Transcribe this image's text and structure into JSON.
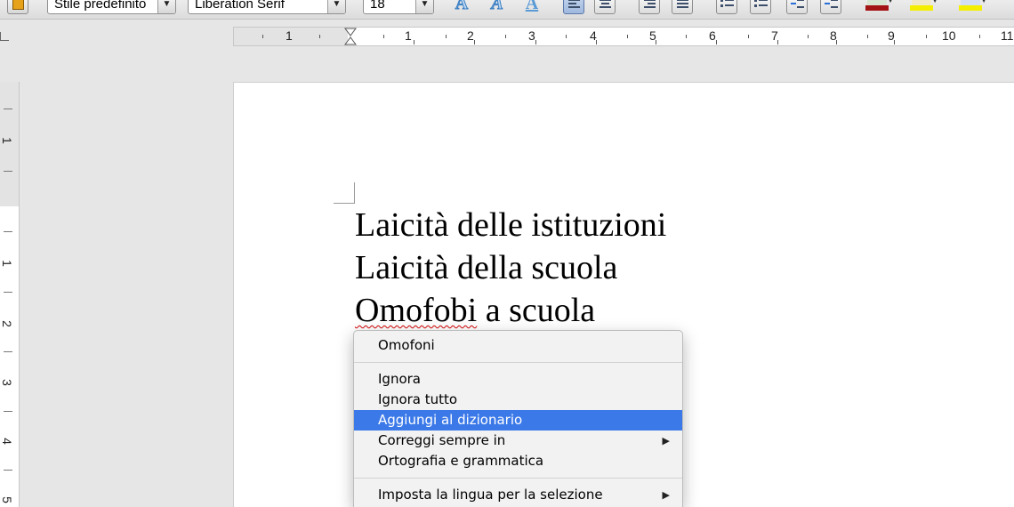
{
  "toolbar": {
    "paragraph_style": "Stile predefinito",
    "font_name": "Liberation Serif",
    "font_size": "18",
    "font_color": "#a31515",
    "highlight_color": "#f4ee00",
    "background_color": "#f4ee00"
  },
  "ruler": {
    "numbers": [
      "1",
      "1",
      "2",
      "3",
      "4",
      "5",
      "6",
      "7",
      "8",
      "9",
      "10",
      "11"
    ],
    "vertical_numbers": [
      "1",
      "1",
      "2",
      "3",
      "4",
      "5"
    ]
  },
  "document": {
    "lines": [
      "Laicità delle istituzioni",
      "Laicità della scuola"
    ],
    "line3_misspelled": "Omofobi",
    "line3_rest": " a scuola"
  },
  "context_menu": {
    "suggestion": "Omofoni",
    "ignore": "Ignora",
    "ignore_all": "Ignora tutto",
    "add_to_dictionary": "Aggiungi al dizionario",
    "always_correct": "Correggi sempre in",
    "spelling_grammar": "Ortografia e grammatica",
    "set_language_selection": "Imposta la lingua per la selezione",
    "highlighted_item": "Aggiungi al dizionario"
  }
}
